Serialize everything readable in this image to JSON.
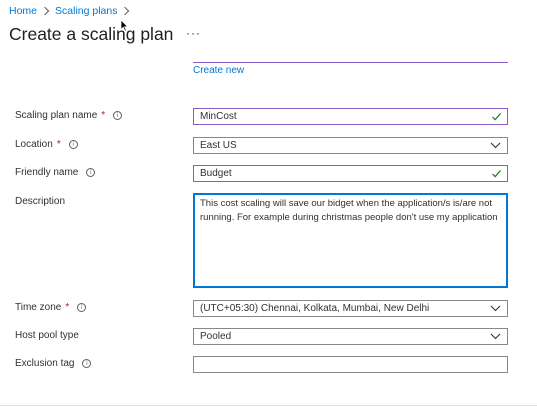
{
  "breadcrumb": {
    "home": "Home",
    "scaling_plans": "Scaling plans"
  },
  "page": {
    "title": "Create a scaling plan",
    "more": "···"
  },
  "create_new": "Create new",
  "form": {
    "name": {
      "label": "Scaling plan name",
      "required": "*",
      "value": "MinCost"
    },
    "location": {
      "label": "Location",
      "required": "*",
      "value": "East US"
    },
    "friendly": {
      "label": "Friendly name",
      "value": "Budget"
    },
    "description": {
      "label": "Description",
      "value": "This cost scaling will save our bidget when the application/s is/are not running. For example during christmas people don't use my application"
    },
    "timezone": {
      "label": "Time zone",
      "required": "*",
      "value": "(UTC+05:30) Chennai, Kolkata, Mumbai, New Delhi"
    },
    "hostpool": {
      "label": "Host pool type",
      "value": "Pooled"
    },
    "exclusion": {
      "label": "Exclusion tag",
      "value": ""
    }
  },
  "colors": {
    "link": "#0078d4",
    "valid_check": "#107c10",
    "focus_border": "#0078d4",
    "accent_border": "#8a5cc7",
    "required": "#a4262c"
  }
}
